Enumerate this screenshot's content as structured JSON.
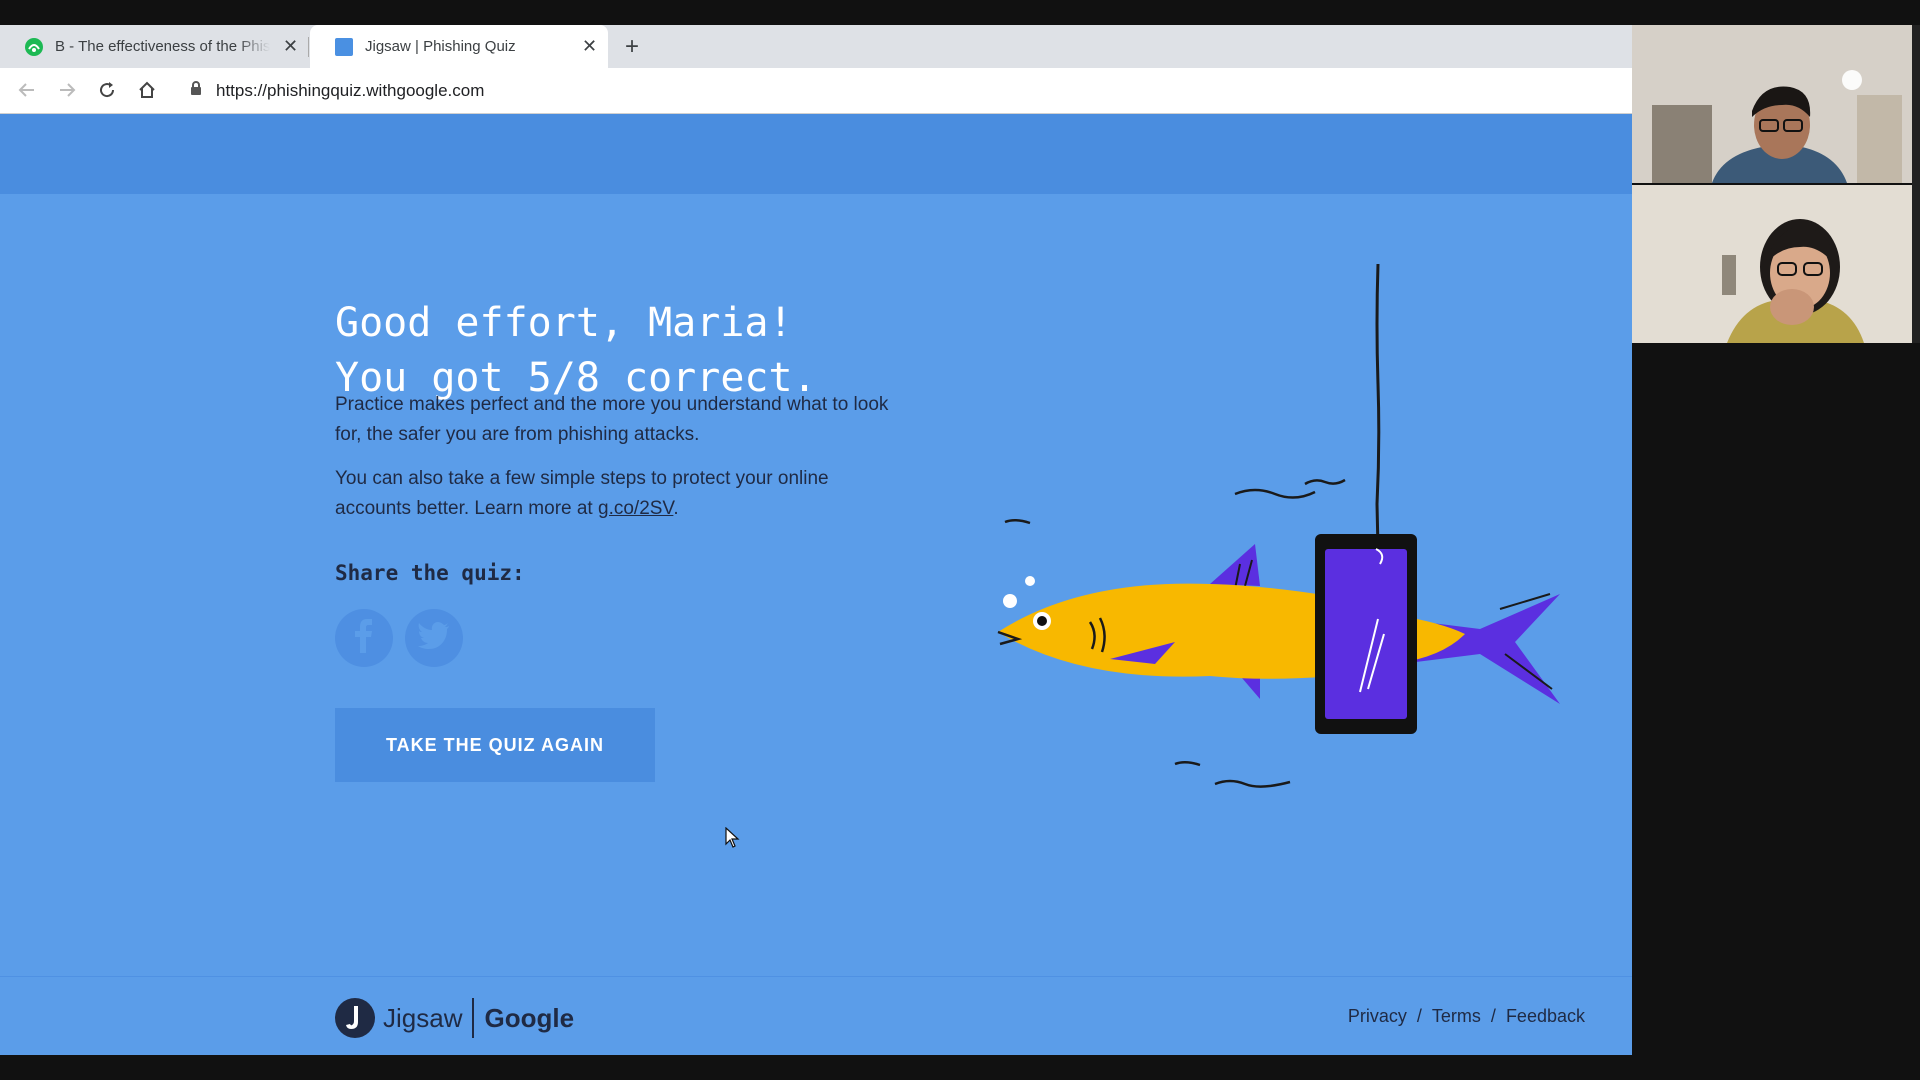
{
  "browser": {
    "tabs": [
      {
        "title": "B - The effectiveness of the Phishing Quiz",
        "active": false,
        "favicon": "green-circle-icon"
      },
      {
        "title": "Jigsaw | Phishing Quiz",
        "active": true,
        "favicon": "blue-square-icon"
      }
    ],
    "url": "https://phishingquiz.withgoogle.com"
  },
  "result": {
    "headline_line1": "Good effort, Maria!",
    "headline_line2": "You got 5/8 correct.",
    "para1": "Practice makes perfect and the more you understand what to look for, the safer you are from phishing attacks.",
    "para2_prefix": "You can also take a few simple steps to protect your online accounts better. Learn more at ",
    "para2_link": "g.co/2SV",
    "para2_suffix": ".",
    "share_label": "Share the quiz:",
    "retake_button": "TAKE THE QUIZ AGAIN"
  },
  "footer": {
    "jigsaw": "Jigsaw",
    "google": "Google",
    "links": [
      "Privacy",
      "Terms",
      "Feedback"
    ],
    "separator": "/"
  },
  "colors": {
    "page_bg": "#5b9de9",
    "header_band": "#4a8ddf",
    "text_dark": "#1f2a44",
    "fish_yellow": "#f8b800",
    "fin_purple": "#5b2fe0"
  }
}
